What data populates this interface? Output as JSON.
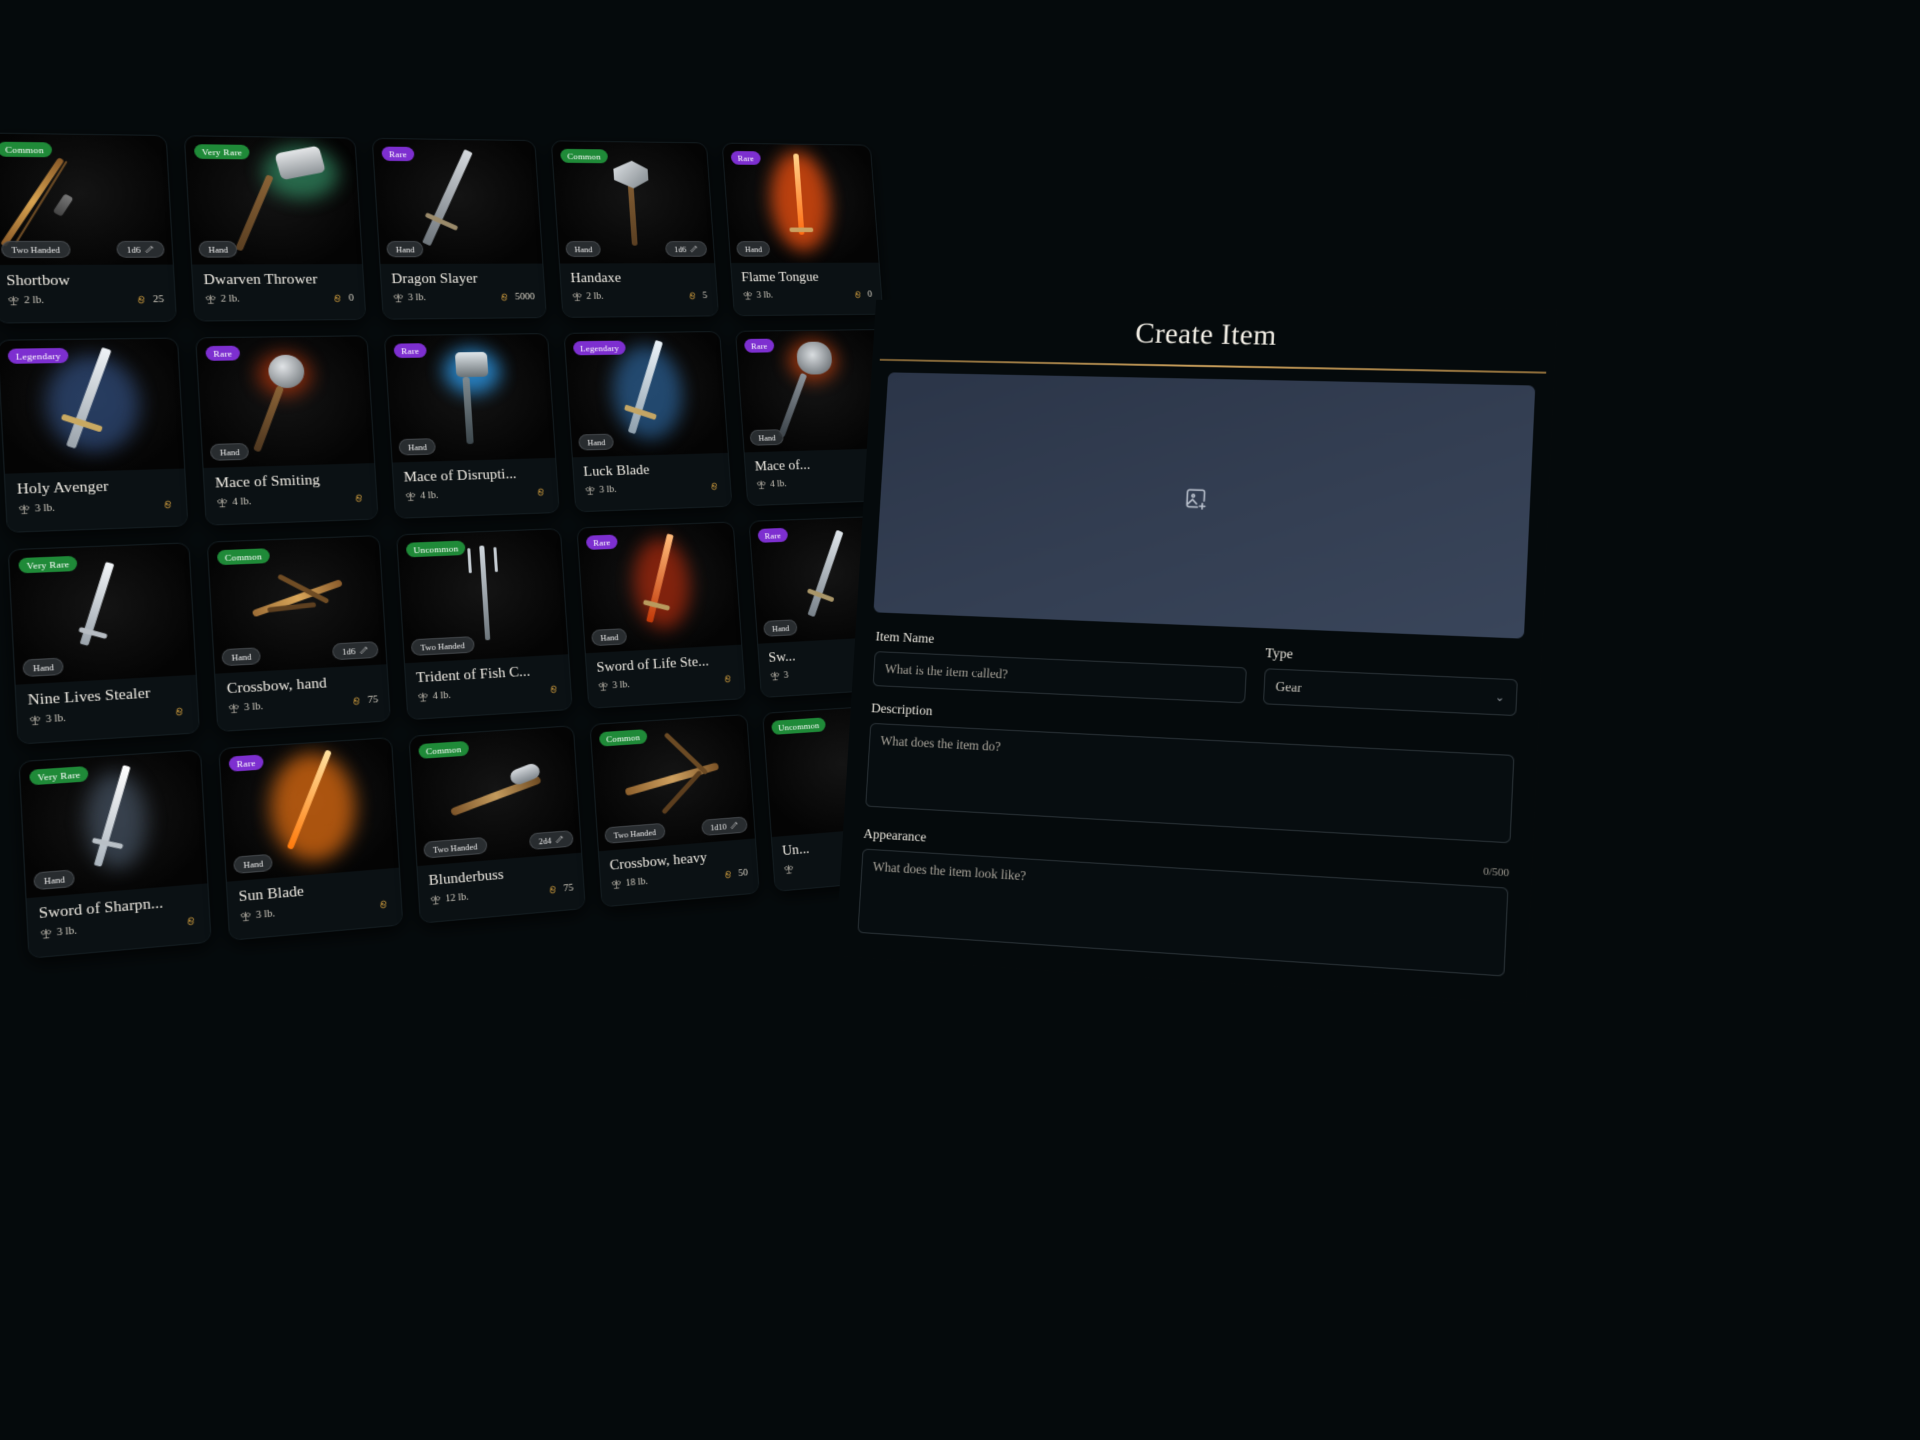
{
  "catalogue": {
    "cards": [
      {
        "name": "Shortbow",
        "rarity": "Common",
        "rarity_class": "r-common",
        "hand": "Two Handed",
        "dice": "1d6",
        "weight": "2 lb.",
        "value": "25",
        "art": "bow-wood"
      },
      {
        "name": "Dwarven Thrower",
        "rarity": "Very Rare",
        "rarity_class": "r-veryrare",
        "hand": "Hand",
        "dice": "",
        "weight": "2 lb.",
        "value": "0",
        "art": "hammer-silver"
      },
      {
        "name": "Dragon Slayer",
        "rarity": "Rare",
        "rarity_class": "r-rare",
        "hand": "Hand",
        "dice": "",
        "weight": "3 lb.",
        "value": "5000",
        "art": "sword-steel"
      },
      {
        "name": "Handaxe",
        "rarity": "Common",
        "rarity_class": "r-common",
        "hand": "Hand",
        "dice": "1d6",
        "weight": "2 lb.",
        "value": "5",
        "art": "axe-wood"
      },
      {
        "name": "Flame Tongue",
        "rarity": "Rare",
        "rarity_class": "r-rare",
        "hand": "Hand",
        "dice": "",
        "weight": "3 lb.",
        "value": "0",
        "art": "sword-flame"
      },
      {
        "name": "Holy Avenger",
        "rarity": "Legendary",
        "rarity_class": "r-legendary",
        "hand": "",
        "dice": "",
        "weight": "3 lb.",
        "value": "",
        "art": "sword-holy"
      },
      {
        "name": "Mace of Smiting",
        "rarity": "Rare",
        "rarity_class": "r-rare",
        "hand": "Hand",
        "dice": "",
        "weight": "4 lb.",
        "value": "",
        "art": "mace-red"
      },
      {
        "name": "Mace of Disrupti...",
        "rarity": "Rare",
        "rarity_class": "r-rare",
        "hand": "Hand",
        "dice": "",
        "weight": "4 lb.",
        "value": "",
        "art": "mace-blue"
      },
      {
        "name": "Luck Blade",
        "rarity": "Legendary",
        "rarity_class": "r-legendary",
        "hand": "Hand",
        "dice": "",
        "weight": "3 lb.",
        "value": "",
        "art": "sword-luck"
      },
      {
        "name": "Mace of...",
        "rarity": "Rare",
        "rarity_class": "r-rare",
        "hand": "Hand",
        "dice": "",
        "weight": "4 lb.",
        "value": "",
        "art": "mace-spike"
      },
      {
        "name": "Nine Lives Stealer",
        "rarity": "Very Rare",
        "rarity_class": "r-veryrare",
        "hand": "Hand",
        "dice": "",
        "weight": "3 lb.",
        "value": "",
        "art": "dagger-white"
      },
      {
        "name": "Crossbow, hand",
        "rarity": "Common",
        "rarity_class": "r-common",
        "hand": "Hand",
        "dice": "1d6",
        "weight": "3 lb.",
        "value": "75",
        "art": "crossbow-wood"
      },
      {
        "name": "Trident of Fish C...",
        "rarity": "Uncommon",
        "rarity_class": "r-uncommon",
        "hand": "Two Handed",
        "dice": "",
        "weight": "4 lb.",
        "value": "",
        "art": "trident"
      },
      {
        "name": "Sword of Life Ste...",
        "rarity": "Rare",
        "rarity_class": "r-rare",
        "hand": "Hand",
        "dice": "",
        "weight": "3 lb.",
        "value": "",
        "art": "sword-red"
      },
      {
        "name": "Sw...",
        "rarity": "Rare",
        "rarity_class": "r-rare",
        "hand": "Hand",
        "dice": "",
        "weight": "3",
        "value": "",
        "art": "sword-plain"
      },
      {
        "name": "Sword of Sharpn...",
        "rarity": "Very Rare",
        "rarity_class": "r-veryrare",
        "hand": "Hand",
        "dice": "",
        "weight": "3 lb.",
        "value": "",
        "art": "sword-sharp"
      },
      {
        "name": "Sun Blade",
        "rarity": "Rare",
        "rarity_class": "r-rare",
        "hand": "Hand",
        "dice": "",
        "weight": "3 lb.",
        "value": "",
        "art": "sword-sun"
      },
      {
        "name": "Blunderbuss",
        "rarity": "Common",
        "rarity_class": "r-common",
        "hand": "Two Handed",
        "dice": "2d4",
        "weight": "12 lb.",
        "value": "75",
        "art": "gun-wood"
      },
      {
        "name": "Crossbow, heavy",
        "rarity": "Common",
        "rarity_class": "r-common",
        "hand": "Two Handed",
        "dice": "1d10",
        "weight": "18 lb.",
        "value": "50",
        "art": "crossbow-heavy"
      },
      {
        "name": "Un...",
        "rarity": "Uncommon",
        "rarity_class": "r-uncommon",
        "hand": "",
        "dice": "",
        "weight": "",
        "value": "",
        "art": "blank"
      }
    ],
    "icons": {
      "weight_icon": "scale-icon",
      "value_icon": "coins-icon",
      "dice_icon": "dice-icon"
    }
  },
  "dialog": {
    "title": "Create Item",
    "image_drop": {
      "icon": "image-plus-icon"
    },
    "fields": {
      "item_name": {
        "label": "Item Name",
        "placeholder": "What is the item called?",
        "value": ""
      },
      "type": {
        "label": "Type",
        "value": "Gear",
        "chevron": "⌄"
      },
      "description": {
        "label": "Description",
        "placeholder": "What does the item do?",
        "value": ""
      },
      "appearance": {
        "label": "Appearance",
        "placeholder": "What does the item look like?",
        "value": "",
        "counter": "0/500"
      }
    }
  },
  "colors": {
    "background": "#050a0c",
    "card_bg": "#0b1114",
    "gold": "#c79d5a",
    "green_badge": "#1f8a38",
    "purple_badge": "#7d2fd0",
    "coin": "#d9a441"
  }
}
